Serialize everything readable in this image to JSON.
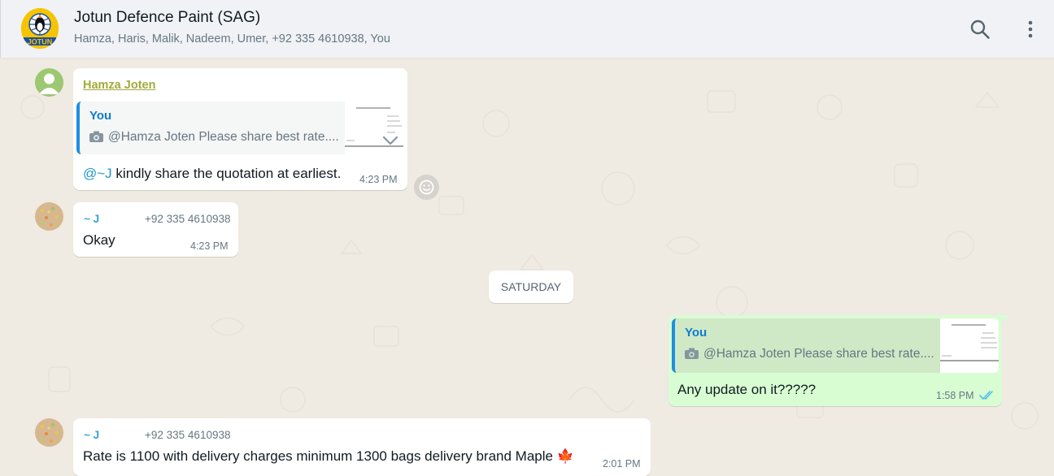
{
  "header": {
    "title": "Jotun Defence Paint (SAG)",
    "members": "Hamza, Haris, Malik, Nadeem, Umer, +92 335 4610938, You",
    "logo_text": "JOTUN",
    "search_icon": "search-icon",
    "menu_icon": "more-vert-icon"
  },
  "messages": [
    {
      "sender": "Hamza Joten",
      "quote_author": "You",
      "quote_text": "@Hamza Joten Please share best rate....",
      "mention": "@~J",
      "text": " kindly share the quotation at earliest.",
      "time": "4:23 PM"
    },
    {
      "sender": "~ J",
      "phone": "+92 335 4610938",
      "text": "Okay",
      "time": "4:23 PM"
    },
    {
      "quote_author": "You",
      "quote_text": "@Hamza Joten Please share best rate....",
      "text": "Any update on it?????",
      "time": "1:58 PM",
      "status": "read"
    },
    {
      "sender": "~ J",
      "phone": "+92 335 4610938",
      "text": "Rate is 1100 with delivery charges minimum 1300 bags delivery brand Maple 🍁",
      "time": "2:01 PM"
    }
  ],
  "date_divider": "SATURDAY",
  "colors": {
    "header_bg": "#f0f2f5",
    "chat_bg": "#efeae2",
    "outgoing_bubble": "#d9fdd3",
    "incoming_bubble": "#ffffff",
    "read_ticks": "#53bdeb",
    "quote_bar": "#1d8fe1"
  }
}
